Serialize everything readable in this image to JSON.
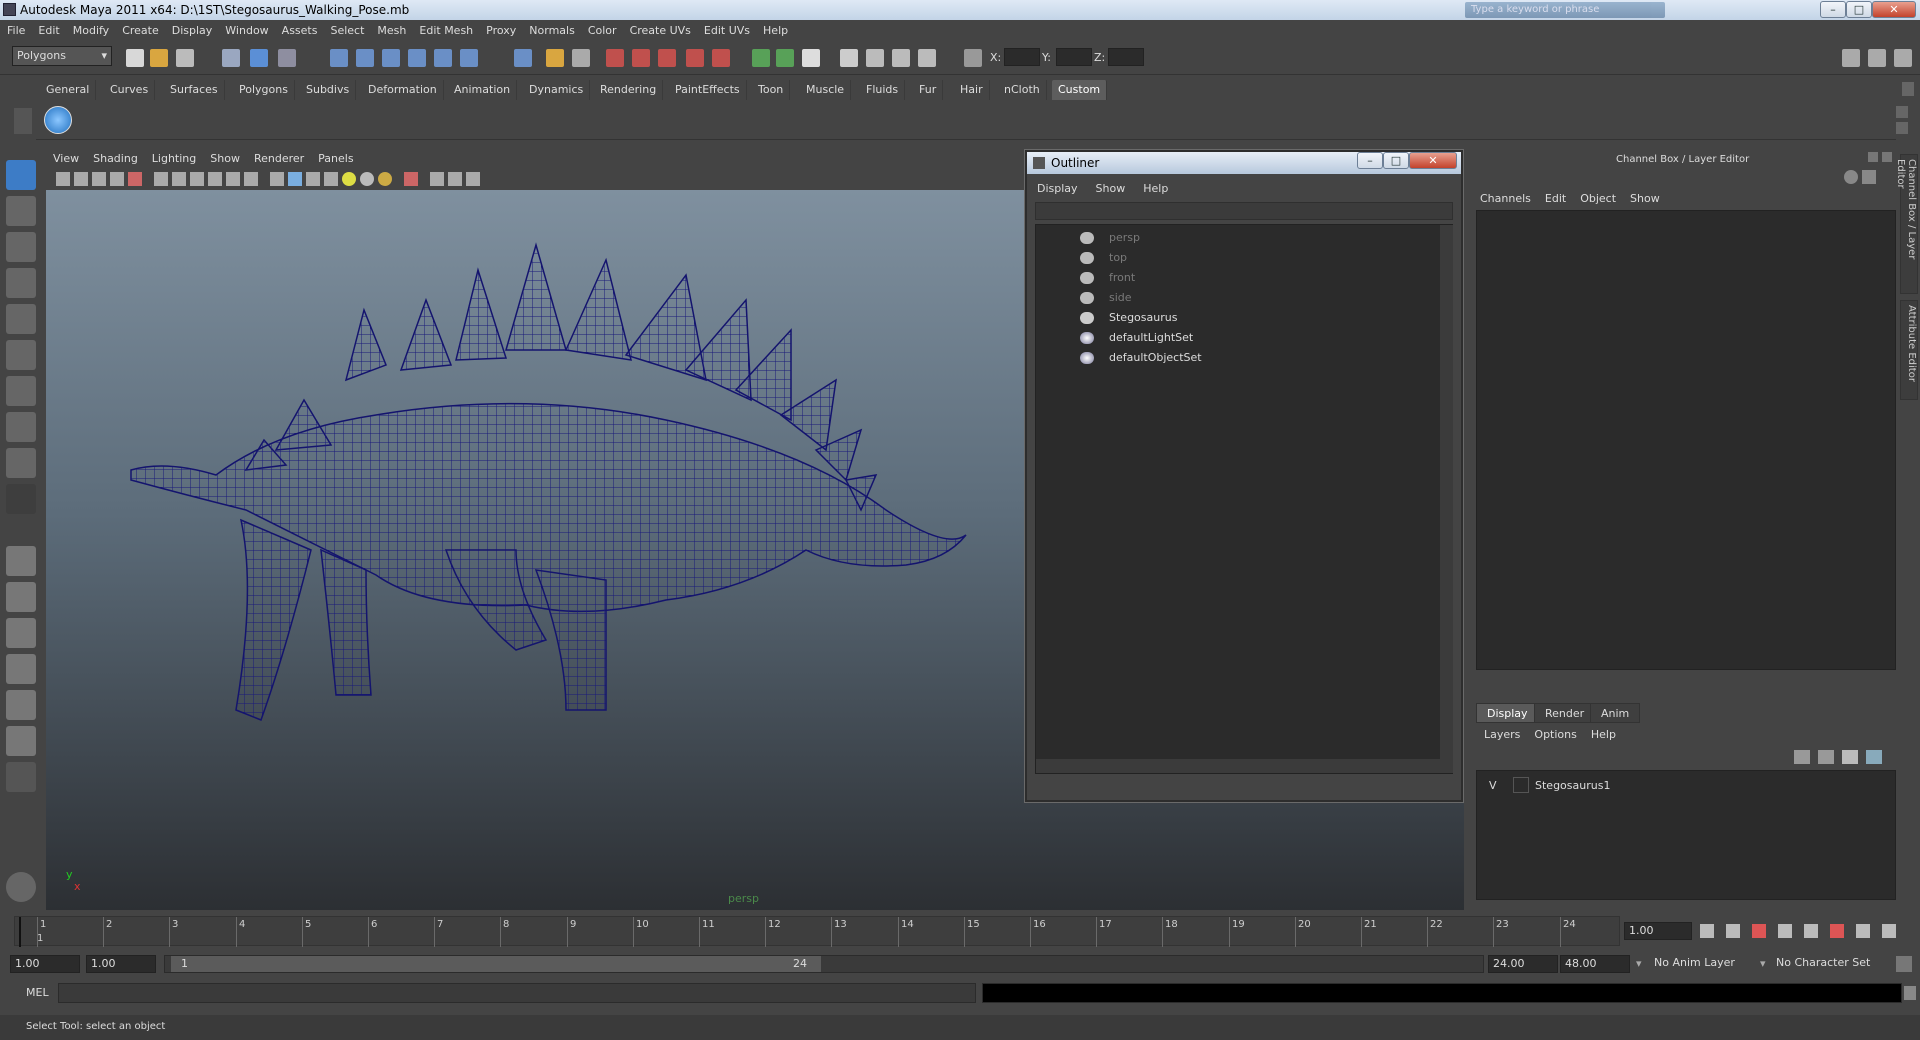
{
  "window": {
    "title": "Autodesk Maya 2011 x64: D:\\1ST\\Stegosaurus_Walking_Pose.mb",
    "search_placeholder": "Type a keyword or phrase",
    "min": "–",
    "max": "□",
    "close": "✕"
  },
  "menubar": [
    "File",
    "Edit",
    "Modify",
    "Create",
    "Display",
    "Window",
    "Assets",
    "Select",
    "Mesh",
    "Edit Mesh",
    "Proxy",
    "Normals",
    "Color",
    "Create UVs",
    "Edit UVs",
    "Help"
  ],
  "statusline": {
    "mode": "Polygons",
    "x_label": "X:",
    "y_label": "Y:",
    "z_label": "Z:"
  },
  "shelf_tabs": [
    "General",
    "Curves",
    "Surfaces",
    "Polygons",
    "Subdivs",
    "Deformation",
    "Animation",
    "Dynamics",
    "Rendering",
    "PaintEffects",
    "Toon",
    "Muscle",
    "Fluids",
    "Fur",
    "Hair",
    "nCloth",
    "Custom"
  ],
  "active_shelf_tab": "Custom",
  "viewport": {
    "menu": [
      "View",
      "Shading",
      "Lighting",
      "Show",
      "Renderer",
      "Panels"
    ],
    "camera_label": "persp",
    "axis_y": "y",
    "axis_x": "x"
  },
  "outliner": {
    "title": "Outliner",
    "menu": [
      "Display",
      "Show",
      "Help"
    ],
    "items": [
      {
        "label": "persp",
        "kind": "camera"
      },
      {
        "label": "top",
        "kind": "camera"
      },
      {
        "label": "front",
        "kind": "camera"
      },
      {
        "label": "side",
        "kind": "camera"
      },
      {
        "label": "Stegosaurus",
        "kind": "object"
      },
      {
        "label": "defaultLightSet",
        "kind": "set"
      },
      {
        "label": "defaultObjectSet",
        "kind": "set"
      }
    ]
  },
  "channel_box": {
    "title": "Channel Box / Layer Editor",
    "menu": [
      "Channels",
      "Edit",
      "Object",
      "Show"
    ],
    "layer_tabs": [
      "Display",
      "Render",
      "Anim"
    ],
    "layer_menu": [
      "Layers",
      "Options",
      "Help"
    ],
    "layer_row": {
      "visibility": "V",
      "name": "Stegosaurus1"
    }
  },
  "side_tabs": [
    "Channel Box / Layer Editor",
    "Attribute Editor"
  ],
  "timeline": {
    "ticks": [
      "1",
      "2",
      "3",
      "4",
      "5",
      "6",
      "7",
      "8",
      "9",
      "10",
      "11",
      "12",
      "13",
      "14",
      "15",
      "16",
      "17",
      "18",
      "19",
      "20",
      "21",
      "22",
      "23",
      "24"
    ],
    "current_frame_marker": "1",
    "current_time": "1.00"
  },
  "range": {
    "start": "1.00",
    "playback_start": "1.00",
    "slider_start": "1",
    "slider_end": "24",
    "playback_end": "24.00",
    "end": "48.00",
    "anim_layer": "No Anim Layer",
    "char_set": "No Character Set"
  },
  "command_line": {
    "label": "MEL"
  },
  "help_line": "Select Tool: select an object"
}
